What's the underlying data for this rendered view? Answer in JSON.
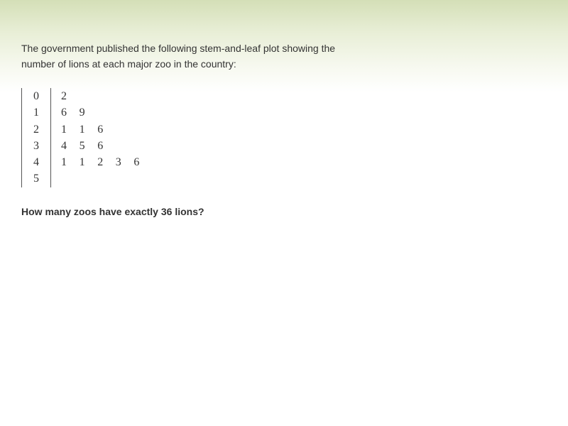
{
  "intro_text": "The government published the following stem-and-leaf plot showing the number of lions at each major zoo in the country:",
  "stem_leaf": {
    "rows": [
      {
        "stem": "0",
        "leaves": [
          "2"
        ]
      },
      {
        "stem": "1",
        "leaves": [
          "6",
          "9"
        ]
      },
      {
        "stem": "2",
        "leaves": [
          "1",
          "1",
          "6"
        ]
      },
      {
        "stem": "3",
        "leaves": [
          "4",
          "5",
          "6"
        ]
      },
      {
        "stem": "4",
        "leaves": [
          "1",
          "1",
          "2",
          "3",
          "6"
        ]
      },
      {
        "stem": "5",
        "leaves": []
      }
    ]
  },
  "question": "How many zoos have exactly 36 lions?"
}
